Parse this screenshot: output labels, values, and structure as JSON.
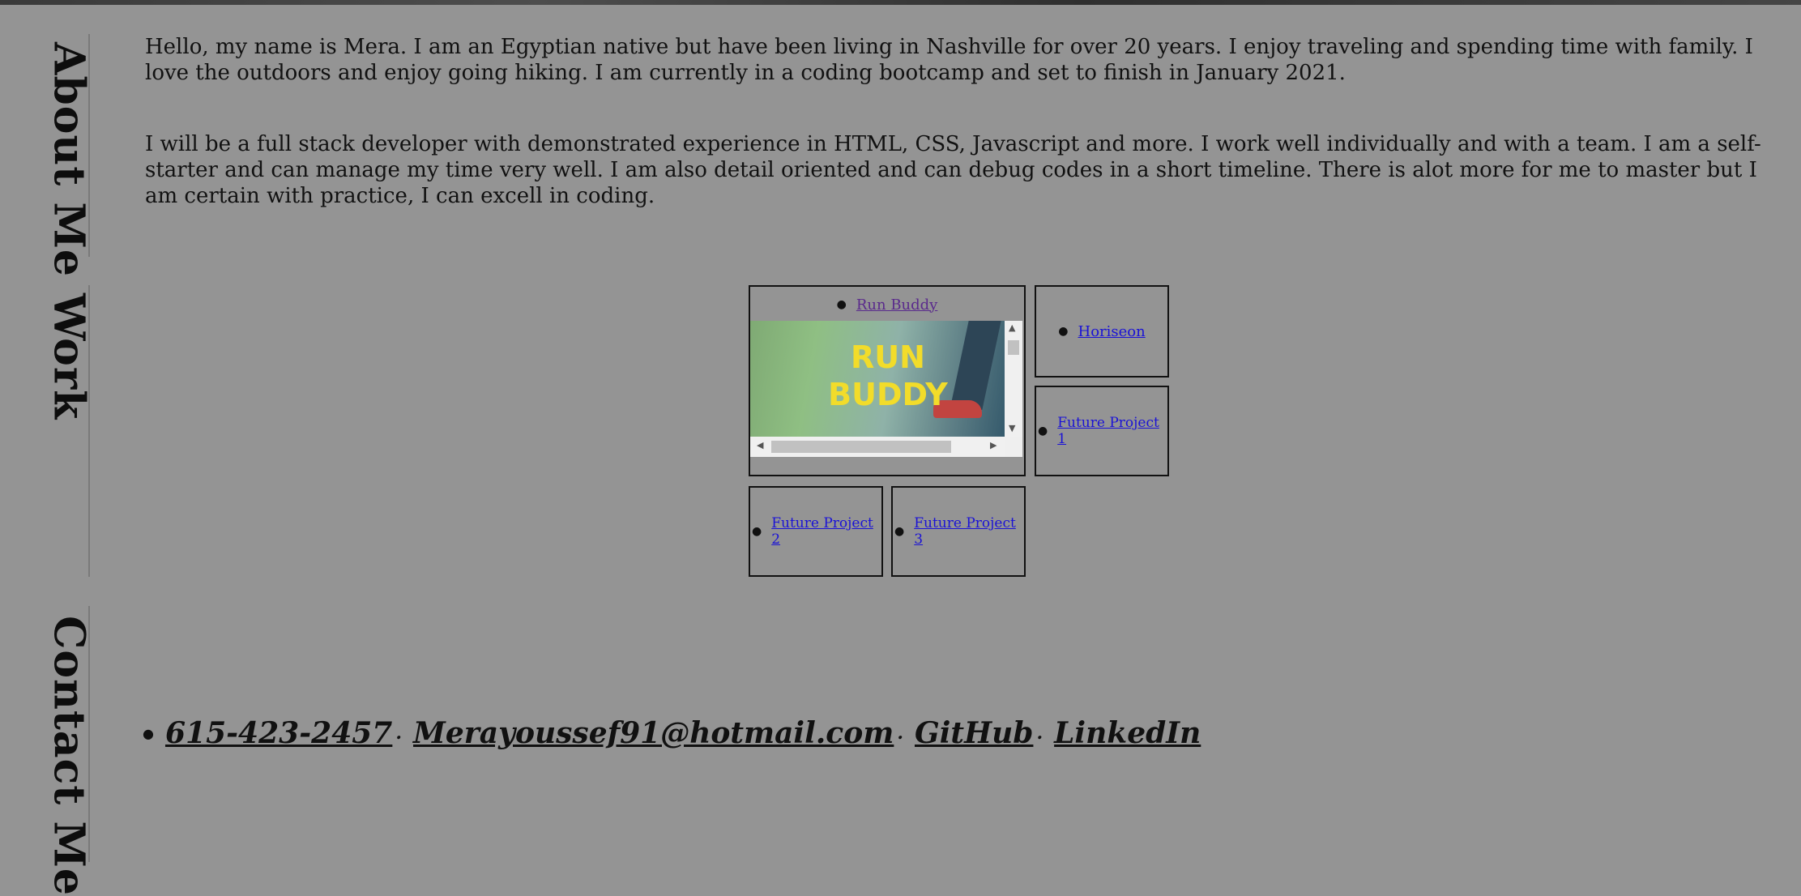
{
  "sections": {
    "about": "About Me",
    "work": "Work",
    "contact": "Contact Me"
  },
  "about": {
    "p1": "Hello, my name is Mera. I am an Egyptian native but have been living in Nashville for over 20 years. I enjoy traveling and spending time with family. I love the outdoors and enjoy going hiking. I am currently in a coding bootcamp and set to finish in January 2021.",
    "p2": "I will be a full stack developer with demonstrated experience in HTML, CSS, Javascript and more. I work well individually and with a team. I am a self-starter and can manage my time very well. I am also detail oriented and can debug codes in a short timeline. There is alot more for me to master but I am certain with practice, I can excell in coding."
  },
  "work": {
    "run_buddy": {
      "label": "Run Buddy",
      "image_text_1": "RUN",
      "image_text_2": "BUDDY"
    },
    "horiseon": "Horiseon",
    "future1": "Future Project 1",
    "future2": "Future Project 2",
    "future3": "Future Project 3"
  },
  "contact": {
    "phone": "615-423-2457",
    "email": "Merayoussef91@hotmail.com",
    "github": "GitHub",
    "linkedin": "LinkedIn"
  },
  "colors": {
    "page_background": "#949494",
    "link": "#1a12d6",
    "visited_link": "#5a2a8c",
    "run_buddy_title": "#f2dc2a"
  }
}
